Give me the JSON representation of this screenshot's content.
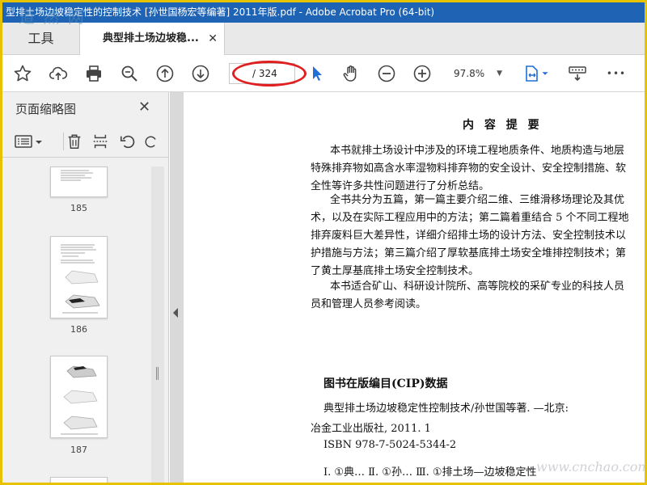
{
  "window": {
    "title": "型排土场边坡稳定性的控制技术 [孙世国杨宏等编著] 2011年版.pdf - Adobe Acrobat Pro (64-bit)"
  },
  "tabs": {
    "tools_label": "工具",
    "doc_label": "典型排土场边坡稳...",
    "close_glyph": "✕"
  },
  "watermark": {
    "top_left": "道 然 网",
    "bottom_right": "www.cnchao.com"
  },
  "toolbar": {
    "page_current": "",
    "page_total": "/ 324",
    "zoom": "97.8%",
    "zoom_caret": "▼",
    "more": "•••"
  },
  "sidebar": {
    "title": "页面缩略图",
    "close_glyph": "✕",
    "thumbnails": [
      {
        "label": "185"
      },
      {
        "label": "186"
      },
      {
        "label": "187"
      }
    ]
  },
  "document": {
    "heading": "内 容 提 要",
    "para1": [
      "本书就排土场设计中涉及的环境工程地质条件、地质构造与地层",
      "特殊排弃物如高含水率湿物料排弃物的安全设计、安全控制措施、软",
      "全性等许多共性问题进行了分析总结。"
    ],
    "para2": [
      "全书共分为五篇，第一篇主要介绍二维、三维滑移场理论及其优",
      "术，以及在实际工程应用中的方法；第二篇着重结合 5 个不同工程地",
      "排弃废料巨大差异性，详细介绍排土场的设计方法、安全控制技术以",
      "护措施与方法；第三篇介绍了厚软基底排土场安全堆排控制技术；第",
      "了黄土厚基底排土场安全控制技术。"
    ],
    "para3": [
      "本书适合矿山、科研设计院所、高等院校的采矿专业的科技人员",
      "员和管理人员参考阅读。"
    ],
    "cip_title": "图书在版编目(CIP)数据",
    "cip_line1": "典型排土场边坡稳定性控制技术/孙世国等著. —北京:",
    "cip_line2": "冶金工业出版社, 2011. 1",
    "cip_line3": "ISBN 978-7-5024-5344-2",
    "cip_line4": "Ⅰ. ①典…    Ⅱ. ①孙…    Ⅲ. ①排土场—边坡稳定性"
  },
  "colors": {
    "titlebar": "#1f63b4",
    "frame": "#e6c200",
    "annotation": "#e02020",
    "select_cursor": "#1f6fd6"
  }
}
